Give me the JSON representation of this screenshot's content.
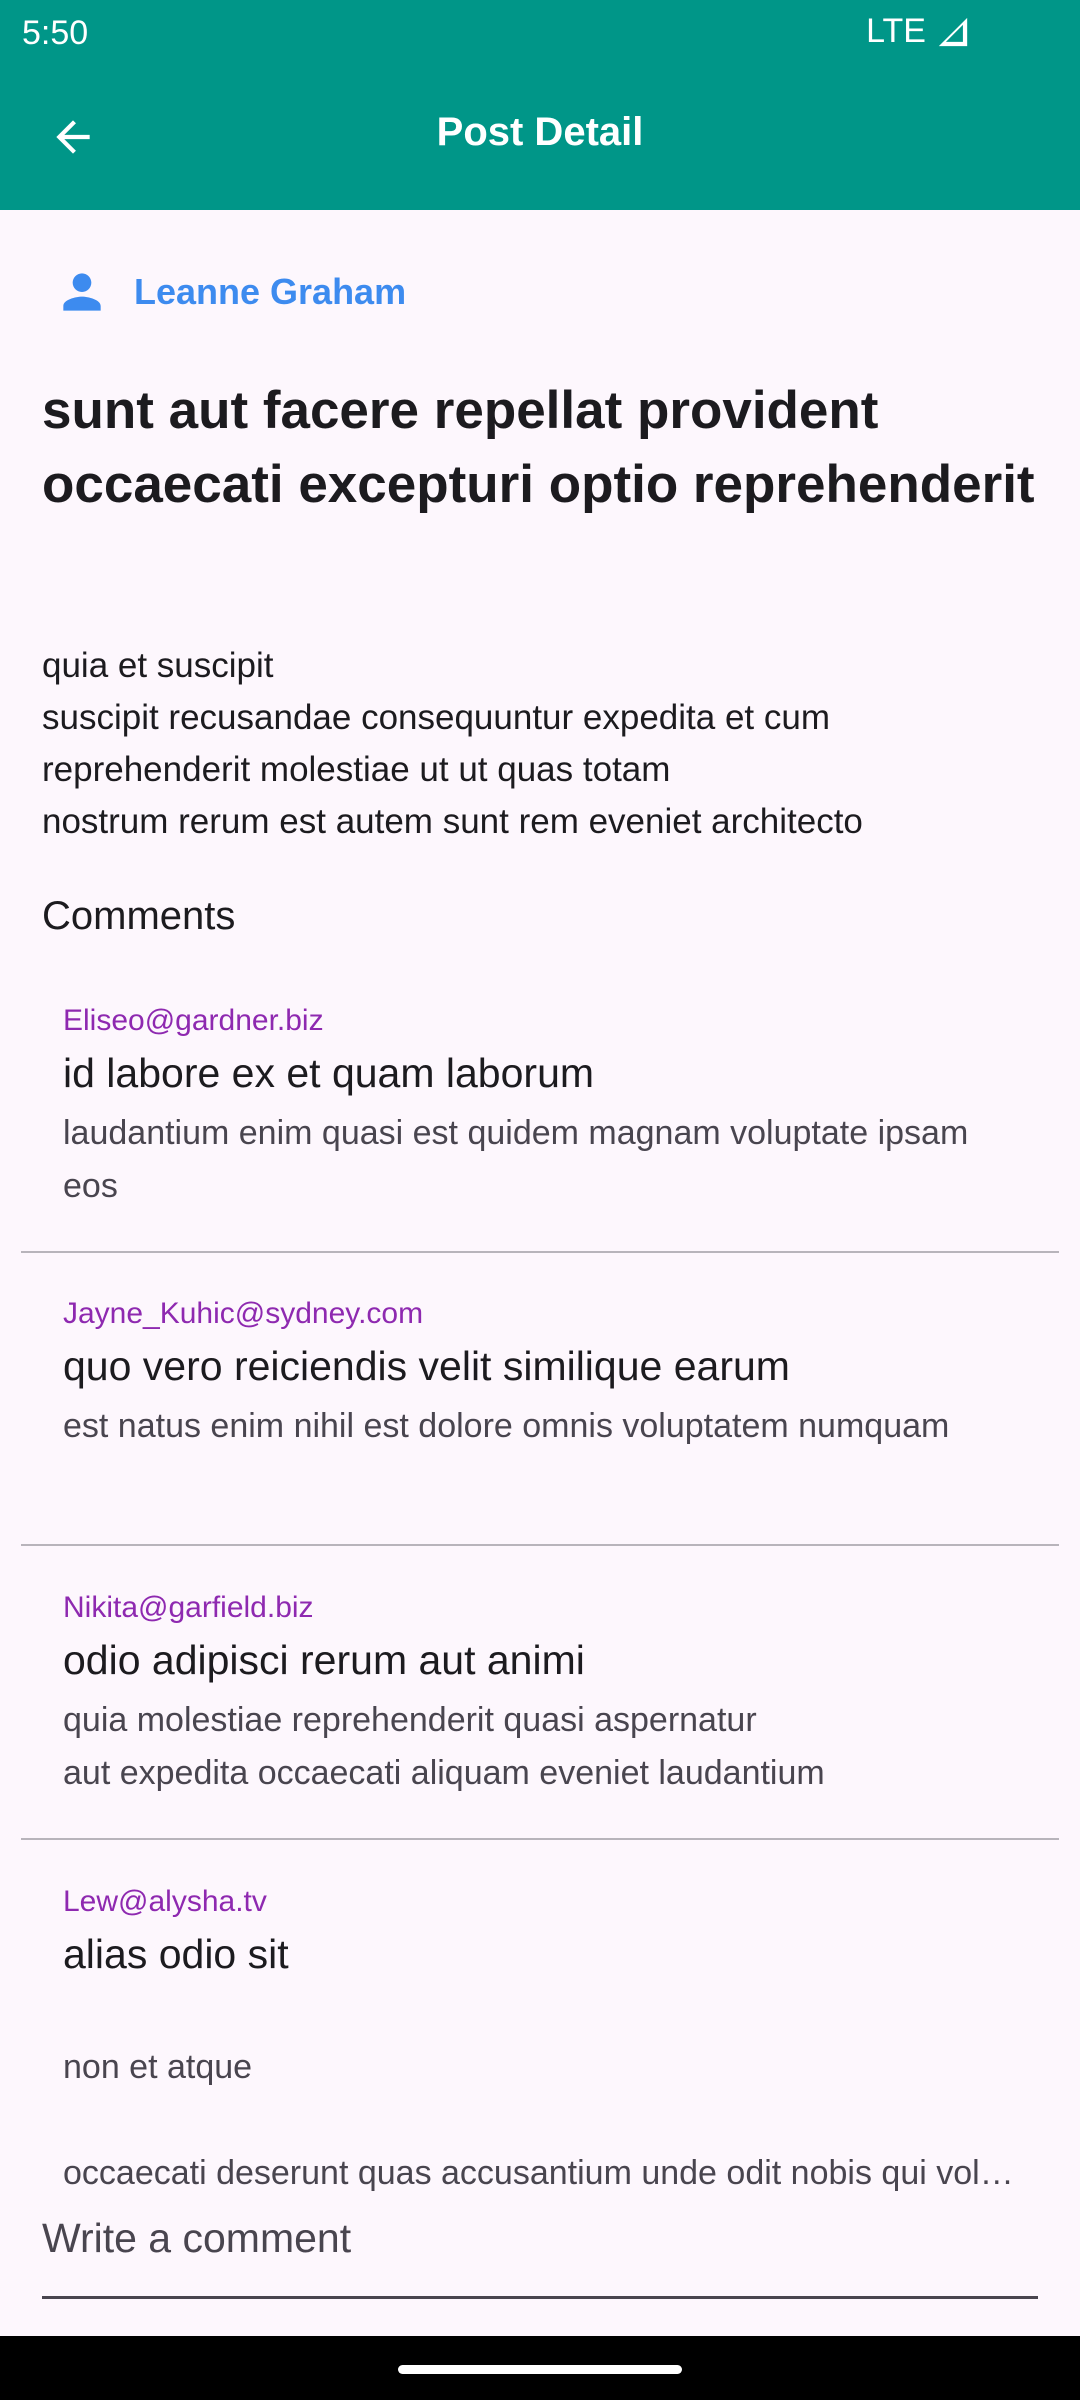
{
  "status_bar": {
    "time": "5:50",
    "network": "LTE",
    "icons": [
      "signal-icon"
    ]
  },
  "app_bar": {
    "title": "Post Detail",
    "back_icon": "arrow-back-icon",
    "background": "#009688"
  },
  "post": {
    "author_icon": "person-icon",
    "author": "Leanne Graham",
    "title": "sunt aut facere repellat provident occaecati excepturi optio reprehenderit",
    "body": "quia et suscipit\nsuscipit recusandae consequuntur expedita et cum\nreprehenderit molestiae ut ut quas totam\nnostrum rerum est autem sunt rem eveniet architecto"
  },
  "comments_heading": "Comments",
  "comments": [
    {
      "email": "Eliseo@gardner.biz",
      "name": "id labore ex et quam laborum",
      "body": "laudantium enim quasi est quidem magnam voluptate ipsam eos"
    },
    {
      "email": "Jayne_Kuhic@sydney.com",
      "name": "quo vero reiciendis velit similique earum",
      "body": "est natus enim nihil est dolore omnis voluptatem numquam"
    },
    {
      "email": "Nikita@garfield.biz",
      "name": "odio adipisci rerum aut animi",
      "body": "quia molestiae reprehenderit quasi aspernatur\naut expedita occaecati aliquam eveniet laudantium"
    },
    {
      "email": "Lew@alysha.tv",
      "name": "alias odio sit",
      "body_line1": "non et atque",
      "body_line2": "occaecati deserunt quas accusantium unde odit nobis qui voluptatem"
    }
  ],
  "comment_input": {
    "placeholder": "Write a comment"
  },
  "colors": {
    "accent": "#009688",
    "author": "#3d8bef",
    "email": "#8e29b0"
  }
}
